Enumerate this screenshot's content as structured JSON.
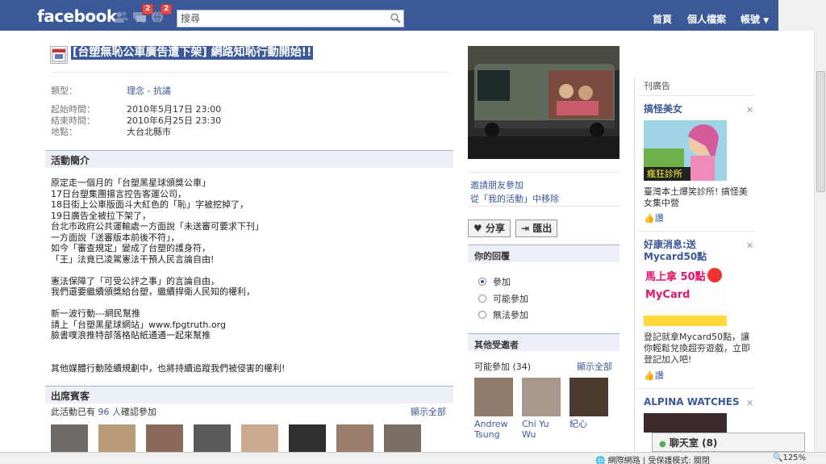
{
  "topbar": {
    "logo": "facebook",
    "jewels": [
      {
        "name": "friend-requests-icon",
        "count": ""
      },
      {
        "name": "messages-icon",
        "count": "2"
      },
      {
        "name": "notifications-icon",
        "count": "2"
      }
    ],
    "search_placeholder": "搜尋",
    "nav": [
      "首頁",
      "個人檔案",
      "帳號"
    ],
    "color": "#3b5998"
  },
  "event": {
    "title": "[台塑無恥公車廣告遭下架] 網路知恥行動開始!!",
    "info": [
      {
        "label": "類型：",
        "value": "理念 - 抗議"
      },
      {
        "label": "起始時間：",
        "value": "2010年5月17日 23:00"
      },
      {
        "label": "結束時間：",
        "value": "2010年6月25日 23:30"
      },
      {
        "label": "地點：",
        "value": "大台北縣市"
      }
    ],
    "desc_heading": "活動簡介",
    "description": [
      "原定走一個月的「台塑黑星球頒獎公車」",
      "17日台塑集團揚言控告客運公司，",
      "18日街上公車版面斗大紅色的「恥」字被挖掉了，",
      "19日廣告全被拉下架了，",
      "台北市政府公共運輸處一方面說「未送審可要求下刊」",
      "一方面說「送審版本前後不符」，",
      "如今「審查規定」變成了台塑的護身符，",
      "「王」法竟已凌駕憲法干預人民言論自由!",
      "",
      "憲法保障了「可受公評之事」的言論自由，",
      "我們還要繼續頒獎給台塑，繼續捍衛人民知的權利，",
      "",
      "新一波行動---網民幫推",
      "請上「台塑黑星球網站」www.fpgtruth.org",
      "臉書噗浪推特部落格貼紙通通一起來幫推",
      "",
      "",
      "其他媒體行動陸續規劃中，也將持續追蹤我們被侵害的權利!"
    ],
    "attend_heading": "出席賓客",
    "attend_text_prefix": "此活動已有",
    "attend_count": "96 人",
    "attend_text_suffix": "確認參加",
    "show_all": "顯示全部"
  },
  "middle": {
    "invite": "邀請朋友參加",
    "remove": "從「我的活動」中移除",
    "share": "分享",
    "export": "匯出",
    "rsvp_heading": "你的回覆",
    "rsvp_options": [
      "參加",
      "可能參加",
      "無法參加"
    ],
    "rsvp_selected": 0,
    "others_heading": "其他受邀者",
    "maybe_label": "可能參加",
    "maybe_count": "(34)",
    "show_all": "顯示全部",
    "friends": [
      "Andrew Tsung",
      "Chi Yu Wu",
      "紀心"
    ]
  },
  "ads": {
    "header": "刊廣告",
    "items": [
      {
        "title": "搞怪美女",
        "text": "臺灣本土爆笑診所! 搞怪美女集中營",
        "like": "讚",
        "image_text": "瘋狂診所"
      },
      {
        "title": "好康消息:送Mycard50點",
        "text": "登記就拿Mycard50點，讓你輕鬆兌換超夯遊戲，立即登記加入吧!",
        "like": "讚",
        "image_text": "馬上拿 50點 MyCard"
      },
      {
        "title": "ALPINA WATCHES",
        "text": "",
        "like": "",
        "image_text": ""
      }
    ]
  },
  "chat": {
    "label": "聊天室 (8)"
  },
  "statusbar": {
    "zone": "網際網路 | 受保護模式: 關閉",
    "zoom": "125%"
  }
}
